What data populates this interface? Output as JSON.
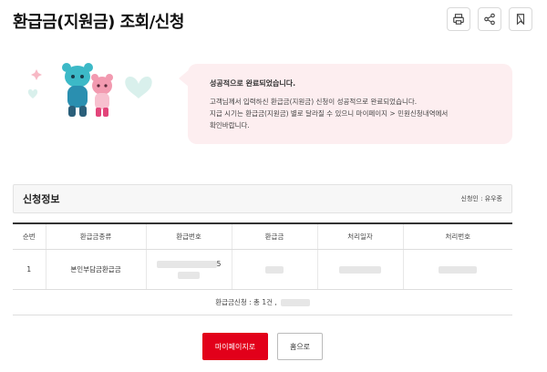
{
  "page": {
    "title": "환급금(지원금) 조회/신청"
  },
  "toolbar": {
    "icons": [
      "print-icon",
      "share-icon",
      "bookmark-icon"
    ]
  },
  "notice": {
    "title": "성공적으로 완료되었습니다.",
    "line1": "고객님께서 입력하신 환급금(지원금) 신청이 성공적으로 완료되었습니다.",
    "line2": "지급 시기는 환급금(지원금) 별로 달라질 수 있으니 마이페이지 > 민원신청내역에서",
    "line3": "확인바랍니다."
  },
  "section": {
    "title": "신청정보",
    "applicant": "신청인 : 유우종"
  },
  "table": {
    "headers": [
      "순번",
      "환급금종류",
      "환급번호",
      "환급금",
      "처리일자",
      "처리번호"
    ],
    "rows": [
      {
        "index": "1",
        "type": "본인부담금환급금",
        "refund_no_suffix": "5"
      }
    ]
  },
  "summary": {
    "label": "환급금신청 : 총 1건 ,"
  },
  "buttons": {
    "mypage": "마이페이지로",
    "home": "홈으로"
  },
  "colors": {
    "primary": "#e2001a",
    "notice_bg": "#fdeef0"
  }
}
